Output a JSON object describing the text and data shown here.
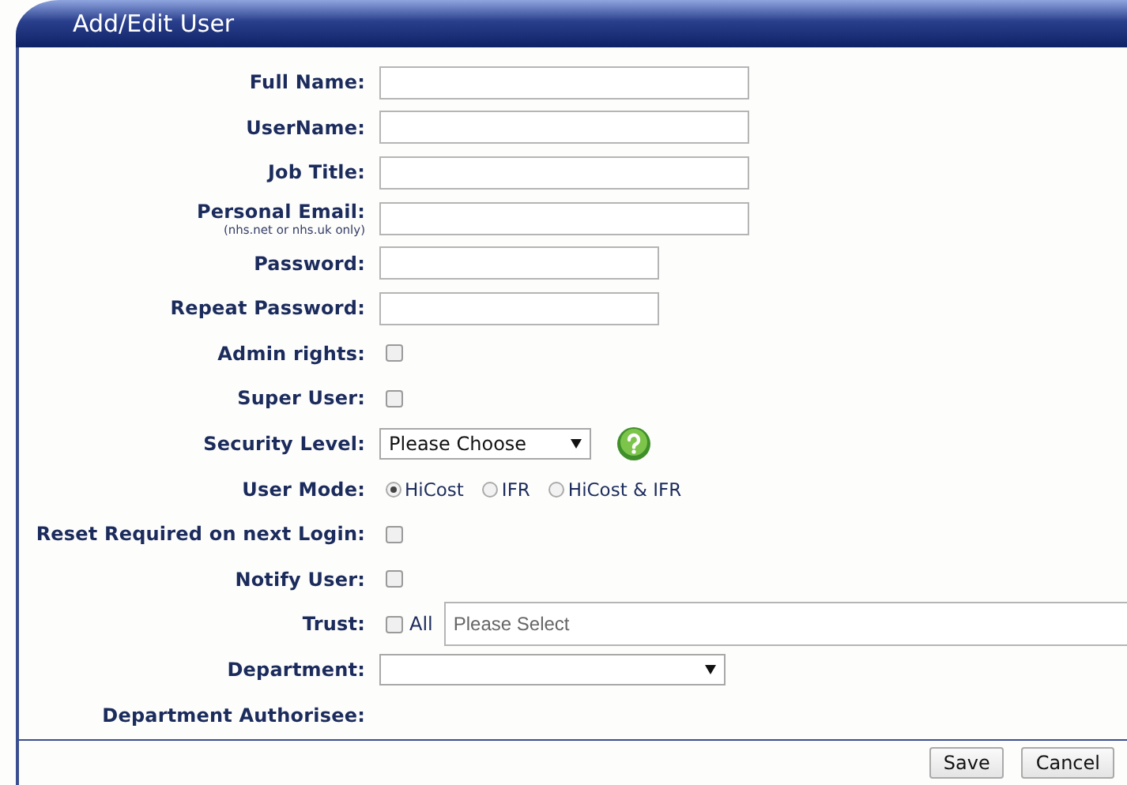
{
  "window": {
    "title": "Add/Edit User"
  },
  "rows": [
    {
      "kind": "text",
      "label": "Full Name:"
    },
    {
      "kind": "text",
      "label": "UserName:"
    },
    {
      "kind": "text",
      "label": "Job Title:"
    },
    {
      "kind": "text",
      "label": "Personal Email:",
      "note": "(nhs.net or nhs.uk only)"
    },
    {
      "kind": "password",
      "label": "Password:"
    },
    {
      "kind": "password",
      "label": "Repeat Password:"
    },
    {
      "kind": "checkbox",
      "label": "Admin rights:",
      "checked": false
    },
    {
      "kind": "checkbox",
      "label": "Super User:",
      "checked": false
    },
    {
      "kind": "short-select",
      "label": "Security Level:",
      "value": "Please Choose",
      "help": true
    },
    {
      "kind": "radio",
      "label": "User Mode:",
      "options": [
        {
          "label": "HiCost",
          "selected": true
        },
        {
          "label": "IFR",
          "selected": false
        },
        {
          "label": "HiCost & IFR",
          "selected": false
        }
      ]
    },
    {
      "kind": "checkbox",
      "label": "Reset Required on next Login:",
      "checked": false
    },
    {
      "kind": "checkbox",
      "label": "Notify User:",
      "checked": false
    },
    {
      "kind": "trust",
      "label": "Trust:",
      "all_label": "All",
      "checked": false,
      "placeholder": "Please Select"
    },
    {
      "kind": "select",
      "label": "Department:",
      "help": false
    },
    {
      "kind": "label",
      "label": "Department Authorisee:"
    }
  ],
  "buttons": [
    "Save",
    "Cancel"
  ]
}
